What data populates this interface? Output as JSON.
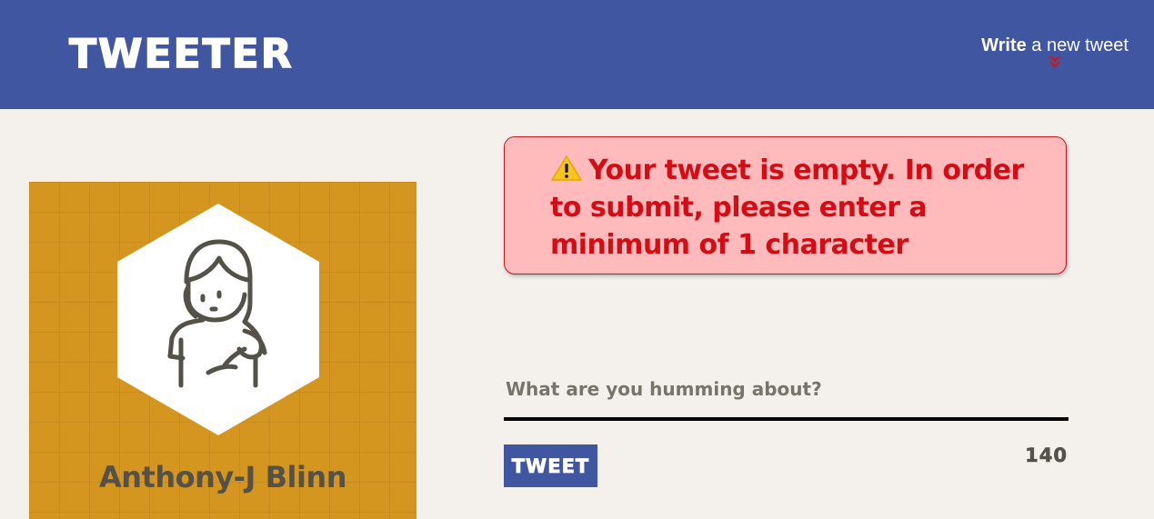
{
  "nav": {
    "brand": "TWEETER",
    "compose_bold": "Write",
    "compose_rest": " a new tweet",
    "compose_icon": "double-chevron-down-icon"
  },
  "profile": {
    "name": "Anthony-J Blinn",
    "avatar": "woman-avatar-icon"
  },
  "error": {
    "icon": "warning-icon",
    "message": "Your tweet is empty. In order to submit, please enter a minimum of 1 character"
  },
  "composer": {
    "placeholder": "What are you humming about?",
    "value": "",
    "button_label": "TWEET",
    "counter": "140"
  },
  "colors": {
    "nav_bg": "#4056a1",
    "page_bg": "#f4f1ec",
    "profile_bg": "#d4961f",
    "error_bg": "#ffbbbb",
    "error_text": "#d30c16",
    "text_dark": "#545149",
    "chevron": "#c41a23"
  }
}
